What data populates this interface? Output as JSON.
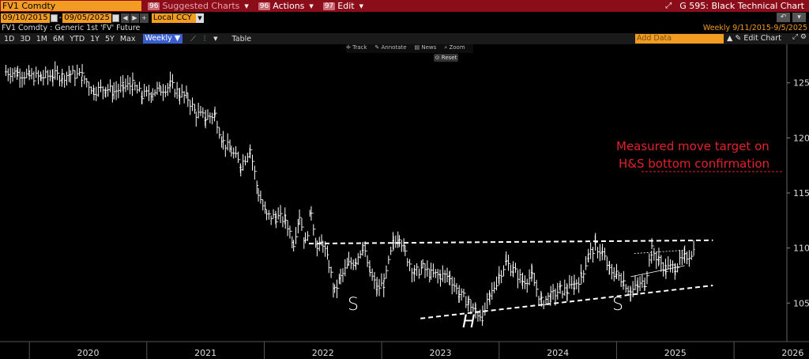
{
  "top_bar": {
    "ticker": "FV1 Comdty",
    "suggested_num": "96",
    "suggested_label": "Suggested Charts",
    "actions_num": "96",
    "actions_label": "Actions",
    "edit_num": "97",
    "edit_label": "Edit",
    "chart_title": "G 595: Black Technical Chart"
  },
  "date_bar": {
    "start_date": "09/10/2015",
    "end_date": "09/05/2025",
    "currency": "Local CCY"
  },
  "security_line": {
    "description": "FV1 Comdty : Generic 1st 'FV' Future",
    "range": "Weekly   9/11/2015-9/5/2025"
  },
  "period_bar": {
    "periods": [
      "1D",
      "3D",
      "1M",
      "6M",
      "YTD",
      "1Y",
      "5Y",
      "Max"
    ],
    "frequency": "Weekly",
    "table": "Table",
    "add_data_placeholder": "Add Data",
    "edit_chart": "Edit Chart"
  },
  "chart_toolbar": {
    "track": "Track",
    "annotate": "Annotate",
    "news": "News",
    "zoom": "Zoom",
    "reset": "Reset"
  },
  "chart_data": {
    "type": "line",
    "title": "",
    "xlabel": "",
    "ylabel": "",
    "x_ticks": [
      "2020",
      "2021",
      "2022",
      "2023",
      "2024",
      "2025",
      "2026"
    ],
    "y_ticks": [
      105,
      110,
      115,
      120,
      125
    ],
    "ylim": [
      101.5,
      128.5
    ],
    "xlim": [
      2019.75,
      2026.45
    ],
    "grid": false,
    "series": [
      {
        "name": "",
        "color": "#ffffff",
        "x": [
          2019.8,
          2019.9,
          2020.0,
          2020.1,
          2020.2,
          2020.28,
          2020.35,
          2020.45,
          2020.55,
          2020.65,
          2020.72,
          2020.8,
          2020.88,
          2020.96,
          2021.05,
          2021.12,
          2021.2,
          2021.28,
          2021.35,
          2021.42,
          2021.5,
          2021.58,
          2021.65,
          2021.72,
          2021.8,
          2021.88,
          2021.95,
          2022.02,
          2022.1,
          2022.18,
          2022.25,
          2022.3,
          2022.35,
          2022.4,
          2022.45,
          2022.5,
          2022.55,
          2022.6,
          2022.65,
          2022.72,
          2022.78,
          2022.84,
          2022.9,
          2022.96,
          2023.02,
          2023.1,
          2023.15,
          2023.2,
          2023.28,
          2023.35,
          2023.42,
          2023.5,
          2023.58,
          2023.66,
          2023.74,
          2023.8,
          2023.86,
          2023.92,
          2024.0,
          2024.06,
          2024.12,
          2024.2,
          2024.28,
          2024.36,
          2024.44,
          2024.52,
          2024.58,
          2024.64,
          2024.7,
          2024.76,
          2024.82,
          2024.88,
          2024.94,
          2025.0,
          2025.06,
          2025.12,
          2025.18,
          2025.24,
          2025.3,
          2025.36,
          2025.42,
          2025.5,
          2025.58,
          2025.66
        ],
        "y": [
          126.0,
          125.9,
          125.6,
          125.5,
          125.7,
          125.6,
          125.8,
          125.6,
          124.3,
          124.5,
          124.2,
          124.6,
          124.8,
          123.8,
          124.2,
          124.4,
          124.8,
          124.0,
          123.6,
          122.2,
          121.8,
          122.1,
          119.6,
          118.8,
          117.5,
          119.0,
          115.0,
          112.9,
          112.8,
          112.6,
          110.5,
          113.0,
          110.4,
          113.4,
          109.9,
          110.5,
          108.5,
          106.0,
          107.3,
          108.5,
          108.9,
          110.2,
          107.8,
          106.3,
          106.8,
          110.5,
          111.2,
          109.5,
          107.7,
          108.2,
          107.6,
          107.5,
          107.4,
          105.8,
          105.1,
          104.2,
          103.8,
          105.5,
          107.5,
          108.7,
          108.0,
          107.0,
          107.4,
          105.1,
          105.6,
          106.2,
          106.1,
          106.7,
          107.4,
          109.3,
          110.2,
          109.5,
          108.0,
          107.6,
          107.0,
          106.0,
          106.5,
          106.9,
          109.8,
          108.9,
          108.1,
          108.3,
          109.1,
          109.8
        ]
      }
    ],
    "annotations": {
      "neckline_label": "",
      "left_shoulder": "S",
      "head": "H",
      "right_shoulder": "S",
      "target_line1": "Measured move target on",
      "target_line2": "H&S bottom confirmation",
      "neckline": {
        "x": [
          2022.38,
          2025.82
        ],
        "y": [
          110.4,
          110.7
        ]
      },
      "trendline": {
        "x": [
          2023.33,
          2025.82
        ],
        "y": [
          103.6,
          106.6
        ]
      },
      "wedge_top": {
        "x": [
          2025.15,
          2025.58
        ],
        "y": [
          109.5,
          109.8
        ]
      },
      "wedge_bottom": {
        "x": [
          2025.12,
          2025.58
        ],
        "y": [
          107.4,
          108.4
        ]
      }
    },
    "line_color": "#ffffff",
    "annotation_color": "#e3212c"
  }
}
